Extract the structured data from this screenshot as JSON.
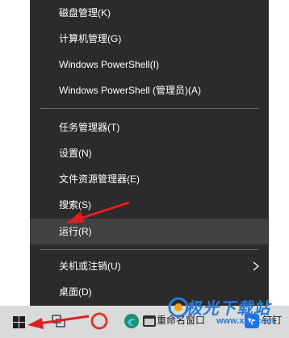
{
  "menu": {
    "items": [
      {
        "label": "磁盘管理(K)"
      },
      {
        "label": "计算机管理(G)"
      },
      {
        "label": "Windows PowerShell(I)"
      },
      {
        "label": "Windows PowerShell (管理员)(A)"
      },
      {
        "label": "任务管理器(T)"
      },
      {
        "label": "设置(N)"
      },
      {
        "label": "文件资源管理器(E)"
      },
      {
        "label": "搜索(S)"
      },
      {
        "label": "运行(R)"
      },
      {
        "label": "关机或注销(U)"
      },
      {
        "label": "桌面(D)"
      }
    ],
    "highlighted_item": "运行(R)",
    "submenu_icon": "chevron-right-icon"
  },
  "taskbar": {
    "items": [
      {
        "icon": "windows-start-icon"
      },
      {
        "icon": "task-view-icon"
      },
      {
        "icon": "app-icon-red"
      },
      {
        "icon": "edge-browser-icon"
      },
      {
        "label": "重命名窗口",
        "icon": "app-window-icon"
      },
      {
        "label": "钉钉",
        "icon": "dingtalk-icon"
      }
    ]
  },
  "annotations": {
    "arrow_color": "#e02020"
  },
  "watermark": {
    "text": "极光下载站",
    "url": "www.xz7.com"
  },
  "colors": {
    "menu_bg": "#2b2b2b",
    "menu_hover": "#414141",
    "separator": "#6a6a6a",
    "taskbar_bg": "#d9dadb"
  }
}
